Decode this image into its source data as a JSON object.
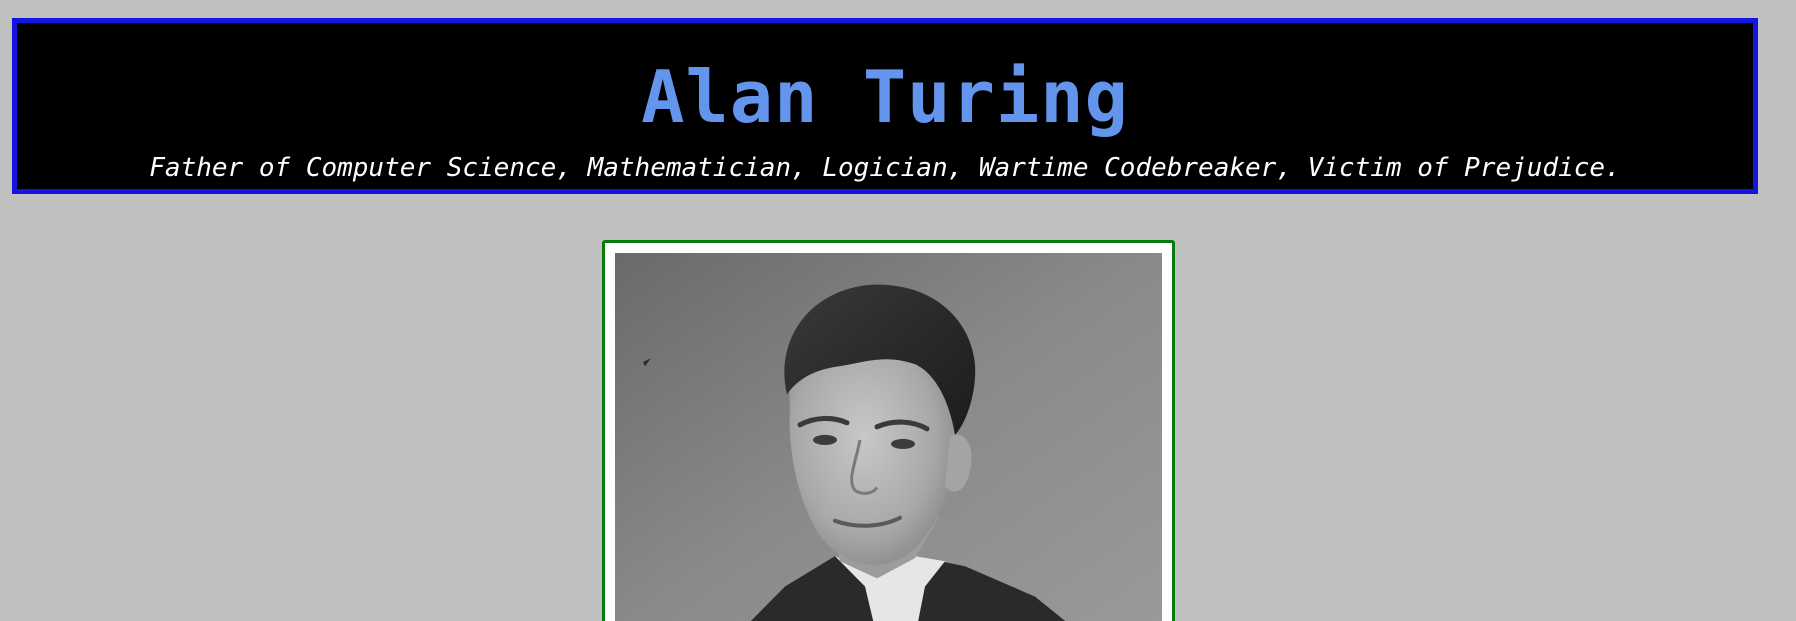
{
  "header": {
    "title": "Alan Turing",
    "subtitle": "Father of Computer Science, Mathematician, Logician, Wartime Codebreaker, Victim of Prejudice."
  },
  "portrait": {
    "description_icon": "portrait-photo"
  },
  "colors": {
    "page_background": "#c0c0c0",
    "header_background": "#000000",
    "header_border": "#1515e0",
    "title_color": "#6495ed",
    "subtitle_color": "#ffffff",
    "photo_border": "#0a7a0a"
  }
}
